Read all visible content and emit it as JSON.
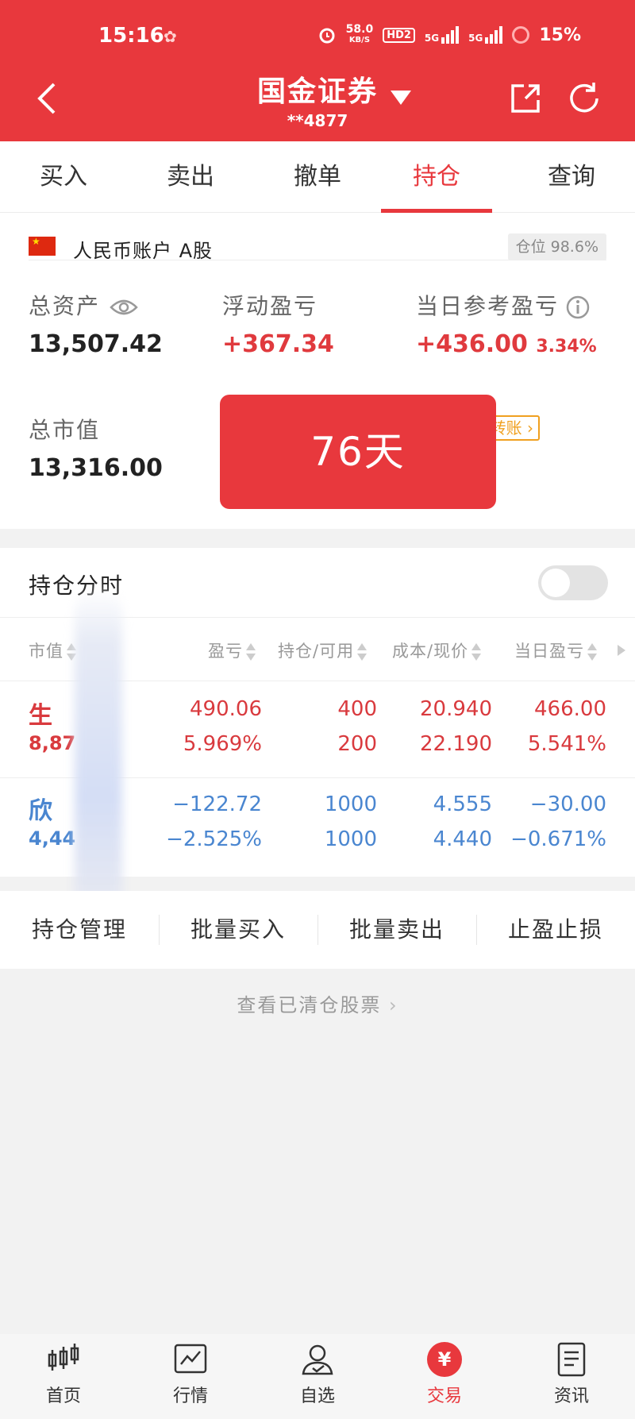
{
  "status": {
    "time": "15:16",
    "speed_top": "58.0",
    "speed_unit": "KB/S",
    "hd": "HD2",
    "net1": "5G",
    "net2": "5G",
    "battery": "15%"
  },
  "header": {
    "title": "国金证券",
    "account_masked": "**4877"
  },
  "tabs": [
    {
      "label": "买入"
    },
    {
      "label": "卖出"
    },
    {
      "label": "撤单"
    },
    {
      "label": "持仓"
    },
    {
      "label": "查询"
    }
  ],
  "account": {
    "label": "人民币账户 A股",
    "position_label": "仓位 98.6%",
    "total_assets_label": "总资产",
    "total_assets": "13,507.42",
    "floating_pnl_label": "浮动盈亏",
    "floating_pnl": "+367.34",
    "day_pnl_label": "当日参考盈亏",
    "day_pnl": "+436.00",
    "day_pnl_pct": "3.34%",
    "market_value_label": "总市值",
    "market_value": "13,316.00",
    "transfer_label": "转账"
  },
  "popup": {
    "text": "76天"
  },
  "holdings": {
    "title": "持仓分时",
    "columns": [
      "市值",
      "盈亏",
      "持仓/可用",
      "成本/现价",
      "当日盈亏"
    ],
    "rows": [
      {
        "name": "生",
        "code": "8,87",
        "pnl": "490.06",
        "pnl_pct": "5.969%",
        "hold": "400",
        "avail": "200",
        "cost": "20.940",
        "price": "22.190",
        "day": "466.00",
        "day_pct": "5.541%",
        "color": "#d93a3e"
      },
      {
        "name": "欣",
        "code": "4,44",
        "pnl": "−122.72",
        "pnl_pct": "−2.525%",
        "hold": "1000",
        "avail": "1000",
        "cost": "4.555",
        "price": "4.440",
        "day": "−30.00",
        "day_pct": "−0.671%",
        "color": "#4a86d0"
      }
    ]
  },
  "actions": [
    {
      "label": "持仓管理"
    },
    {
      "label": "批量买入"
    },
    {
      "label": "批量卖出"
    },
    {
      "label": "止盈止损"
    }
  ],
  "cleared_link": "查看已清仓股票",
  "nav": [
    {
      "label": "首页",
      "icon": "candlestick-icon"
    },
    {
      "label": "行情",
      "icon": "chart-icon"
    },
    {
      "label": "自选",
      "icon": "user-check-icon"
    },
    {
      "label": "交易",
      "icon": "yuan-icon"
    },
    {
      "label": "资讯",
      "icon": "document-icon"
    }
  ],
  "colors": {
    "brand": "#e8383d",
    "up": "#d93a3e",
    "down": "#4a86d0"
  }
}
